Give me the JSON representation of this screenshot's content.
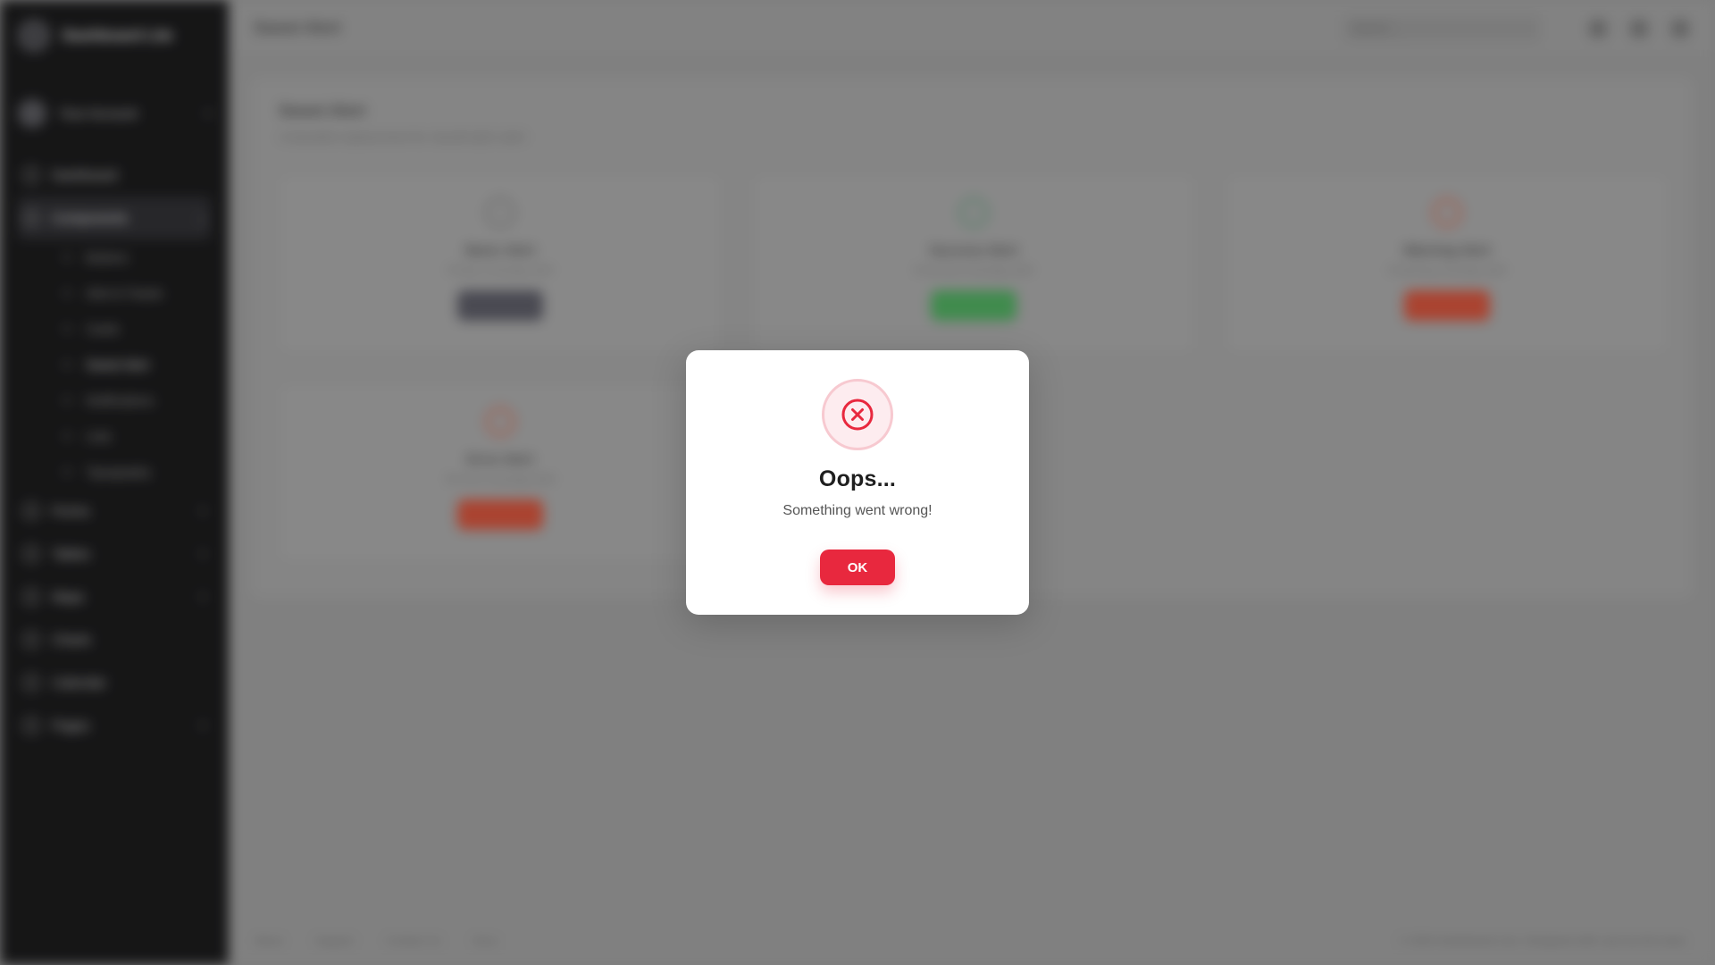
{
  "app": {
    "brand": "Dashboard Lite"
  },
  "sidebar": {
    "profile": "Your Account",
    "items": [
      {
        "label": "Dashboard"
      },
      {
        "label": "Components",
        "active": true,
        "children": [
          "Buttons",
          "Alert & Toasts",
          "Cards",
          "Sweet Alert",
          "Notifications",
          "Lists",
          "Typography"
        ]
      },
      {
        "label": "Forms"
      },
      {
        "label": "Tables"
      },
      {
        "label": "Maps"
      },
      {
        "label": "Charts"
      },
      {
        "label": "Calendar"
      },
      {
        "label": "Pages"
      }
    ]
  },
  "topbar": {
    "title": "Sweet Alert",
    "search_placeholder": "Search..."
  },
  "content": {
    "title": "Sweet Alert",
    "subtitle": "A beautiful replacement for JavaScript's alert",
    "cards": [
      {
        "title": "Basic Alert",
        "desc": "A basic message alert",
        "btn_color": "#4b4b55",
        "icon_color": "#6f6f6f"
      },
      {
        "title": "Success Alert",
        "desc": "A success message alert",
        "btn_color": "#3f9a4f",
        "icon_color": "#4e8a6a"
      },
      {
        "title": "Warning Alert",
        "desc": "A warning message alert",
        "btn_color": "#c0432c",
        "icon_color": "#c0533c"
      },
      {
        "title": "Error Alert",
        "desc": "An error message alert",
        "btn_color": "#c0432c",
        "icon_color": "#c0533c"
      }
    ]
  },
  "footer": {
    "links": [
      "About",
      "Support",
      "Contact Us",
      "Docs"
    ],
    "copyright": "© 2024 Dashboard Lite. Designed with care by the team."
  },
  "dialog": {
    "icon": "x-circle-icon",
    "title": "Oops...",
    "message": "Something went wrong!",
    "ok_label": "OK",
    "accent": "#e8283e",
    "ring_bg": "#fdecef"
  }
}
